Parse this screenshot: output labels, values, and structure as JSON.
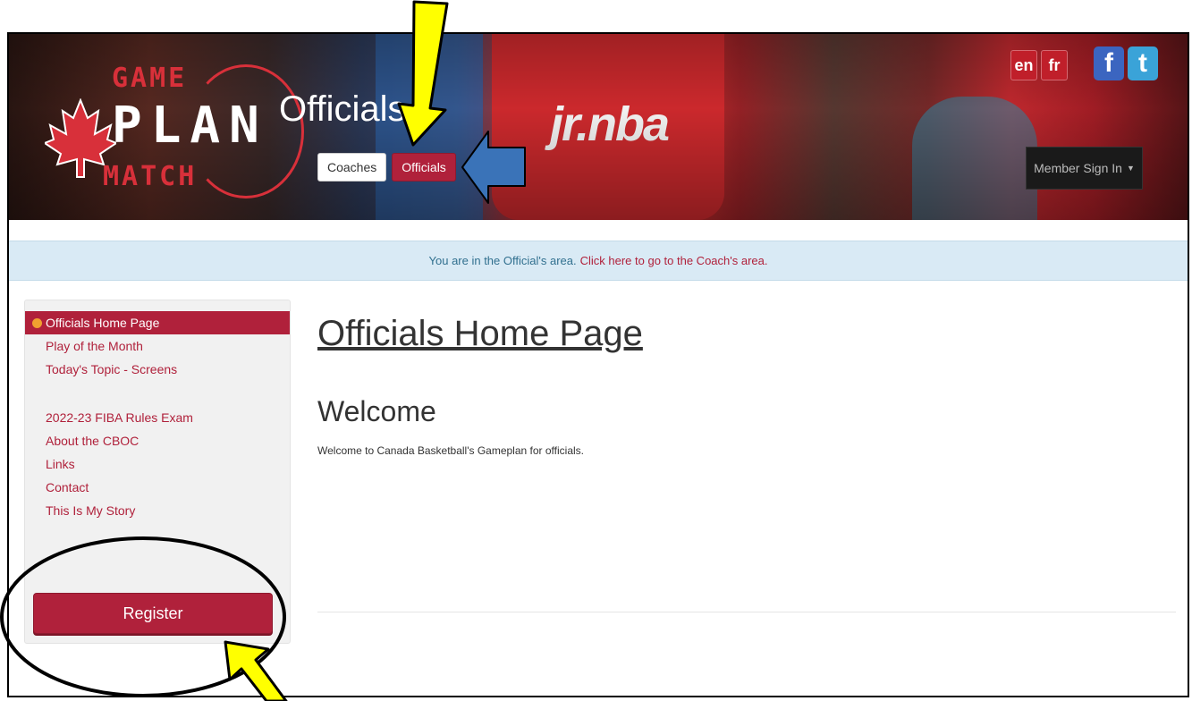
{
  "header": {
    "logo": {
      "line1": "GAME",
      "line2": "PLAN",
      "line3": "MATCH",
      "accent_color": "#d8303a"
    },
    "page_title": "Officials",
    "tabs": [
      {
        "label": "Coaches",
        "active": false
      },
      {
        "label": "Officials",
        "active": true
      }
    ],
    "languages": [
      "en",
      "fr"
    ],
    "social": [
      {
        "icon": "facebook-icon",
        "glyph": "f"
      },
      {
        "icon": "twitter-icon",
        "glyph": "t"
      }
    ],
    "member_signin": "Member Sign In"
  },
  "infobar": {
    "text": "You are in the Official's area.",
    "link": "Click here to go to the Coach's area."
  },
  "sidebar": {
    "items": [
      {
        "label": "Officials Home Page",
        "active": true
      },
      {
        "label": "Play of the Month"
      },
      {
        "label": "Today's Topic - Screens"
      },
      {
        "label": "2022-23 FIBA Rules Exam"
      },
      {
        "label": "About the CBOC"
      },
      {
        "label": "Links"
      },
      {
        "label": "Contact"
      },
      {
        "label": "This Is My Story"
      }
    ],
    "register_label": "Register"
  },
  "main": {
    "heading": "Officials Home Page",
    "subheading": "Welcome",
    "body": "Welcome to Canada Basketball's Gameplan for officials."
  },
  "colors": {
    "brand": "#b0213b",
    "info_bg": "#d9eaf5",
    "annotation_yellow": "#ffff00",
    "annotation_blue": "#3a73b8"
  }
}
